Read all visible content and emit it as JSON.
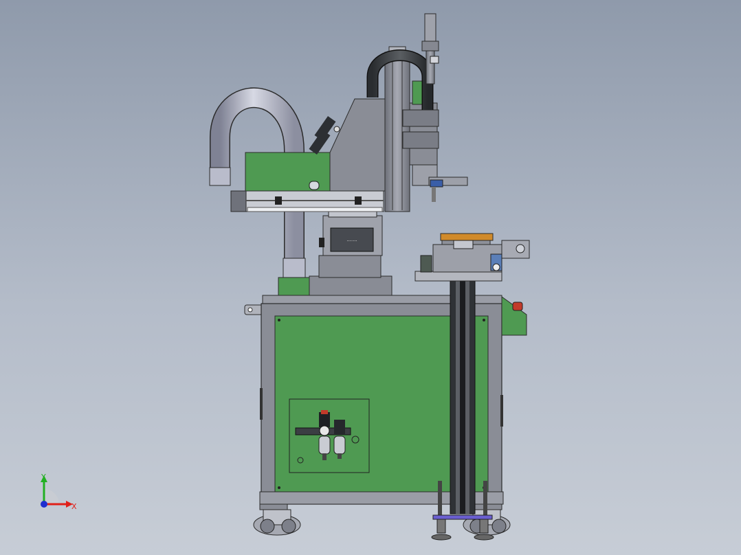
{
  "viewport": {
    "background_top": "#8f9aab",
    "background_bottom": "#c7cdd6"
  },
  "model": {
    "frame_color": "#8a8d96",
    "panel_color": "#4f9a52",
    "edge_color": "#2b2b2b",
    "hose_color": "#b9bccb",
    "accent_orange": "#d08a2a",
    "accent_red": "#c23a2a",
    "nameplate_text": "·······"
  },
  "triad": {
    "x_label": "X",
    "y_label": "Y",
    "x_color": "#e0201a",
    "y_color": "#22b022",
    "z_color": "#1f2fd0"
  }
}
